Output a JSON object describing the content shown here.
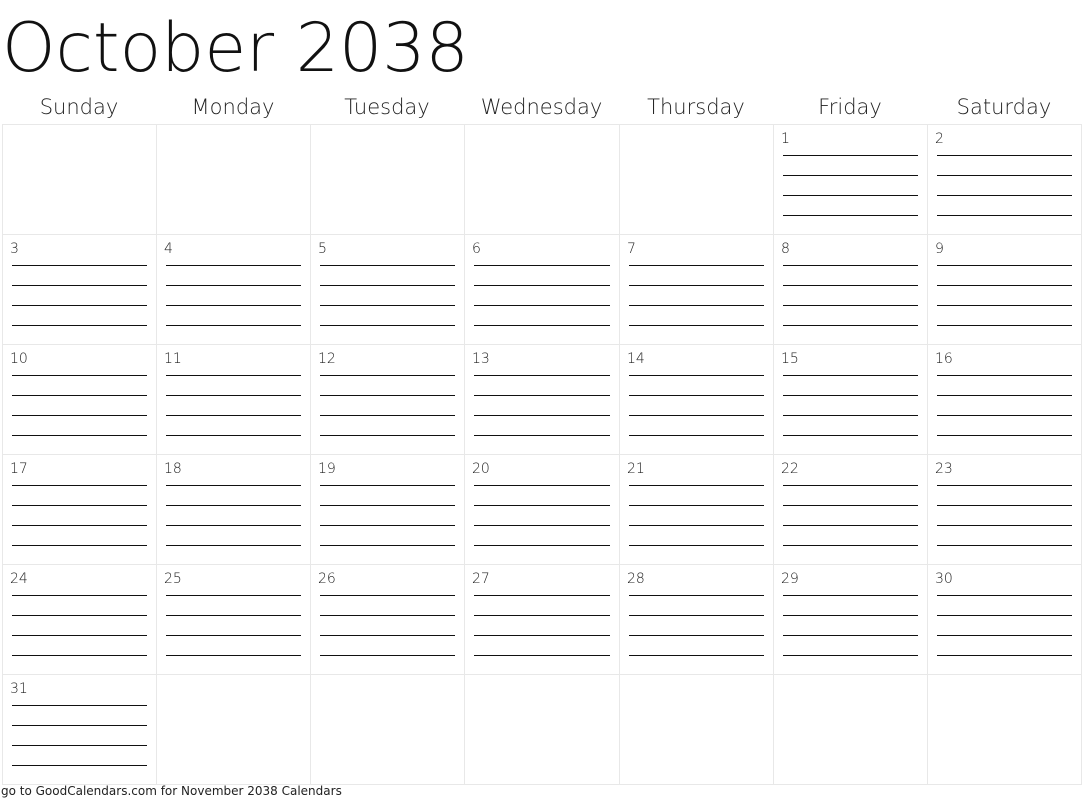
{
  "calendar": {
    "title": "October 2038",
    "weekdays": [
      "Sunday",
      "Monday",
      "Tuesday",
      "Wednesday",
      "Thursday",
      "Friday",
      "Saturday"
    ],
    "weeks": [
      [
        "",
        "",
        "",
        "",
        "",
        "1",
        "2"
      ],
      [
        "3",
        "4",
        "5",
        "6",
        "7",
        "8",
        "9"
      ],
      [
        "10",
        "11",
        "12",
        "13",
        "14",
        "15",
        "16"
      ],
      [
        "17",
        "18",
        "19",
        "20",
        "21",
        "22",
        "23"
      ],
      [
        "24",
        "25",
        "26",
        "27",
        "28",
        "29",
        "30"
      ],
      [
        "31",
        "",
        "",
        "",
        "",
        "",
        ""
      ]
    ],
    "lines_per_day": 4
  },
  "footer": {
    "link_text": "go to GoodCalendars.com for November 2038 Calendars"
  }
}
